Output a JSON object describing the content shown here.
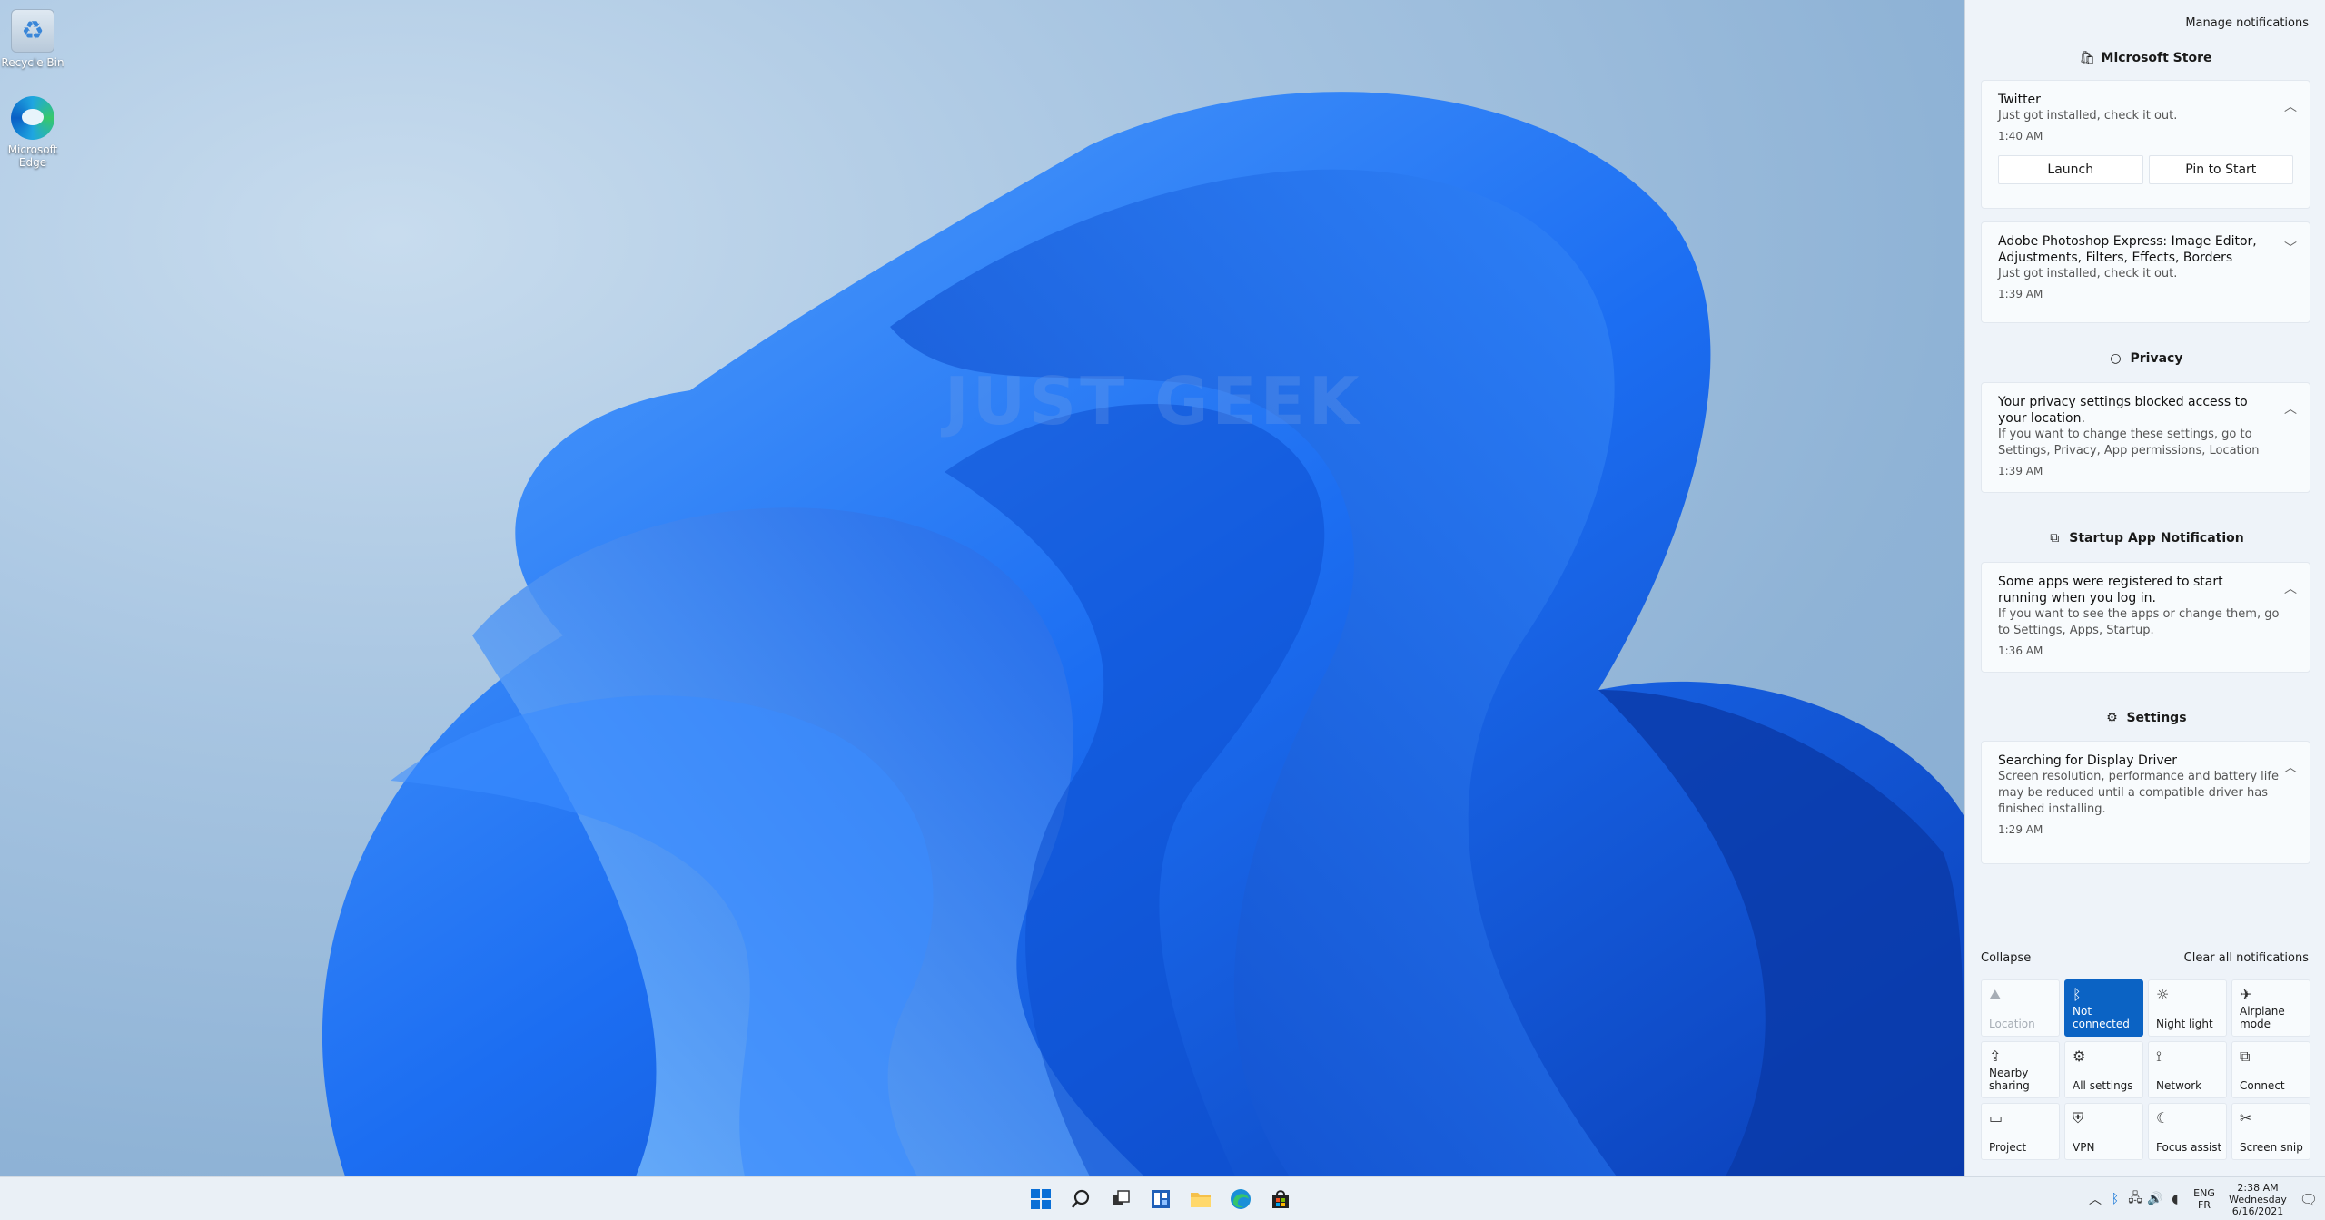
{
  "desktop": {
    "icons": [
      {
        "label": "Recycle Bin",
        "icon": "recycle-bin-icon"
      },
      {
        "label": "Microsoft Edge",
        "icon": "edge-icon"
      }
    ],
    "watermark": "JUST GEEK"
  },
  "action_center": {
    "manage_label": "Manage notifications",
    "groups": [
      {
        "title": "Microsoft Store",
        "icon": "store-bag-icon",
        "notifications": [
          {
            "title": "Twitter",
            "body": "Just got installed, check it out.",
            "time": "1:40 AM",
            "buttons": [
              "Launch",
              "Pin to Start"
            ]
          },
          {
            "title": "Adobe Photoshop Express: Image Editor, Adjustments, Filters, Effects, Borders",
            "body": "Just got installed, check it out.",
            "time": "1:39 AM"
          }
        ]
      },
      {
        "title": "Privacy",
        "icon": "privacy-icon",
        "notifications": [
          {
            "title": "Your privacy settings blocked access to your location.",
            "body": "If you want to change these settings, go to Settings, Privacy, App permissions, Location",
            "time": "1:39 AM"
          }
        ]
      },
      {
        "title": "Startup App Notification",
        "icon": "startup-icon",
        "notifications": [
          {
            "title": "Some apps were registered to start running when you log in.",
            "body": "If you want to see the apps or change them, go to Settings, Apps, Startup.",
            "time": "1:36 AM"
          }
        ]
      },
      {
        "title": "Settings",
        "icon": "gear-icon",
        "notifications": [
          {
            "title": "Searching for Display Driver",
            "body": "Screen resolution, performance and battery life may be reduced until a compatible driver has finished installing.",
            "time": "1:29 AM"
          }
        ]
      }
    ],
    "collapse_label": "Collapse",
    "clear_label": "Clear all notifications",
    "quick_actions": [
      {
        "label": "Location",
        "icon": "location-icon",
        "state": "disabled"
      },
      {
        "label": "Not connected",
        "icon": "bluetooth-icon",
        "state": "on"
      },
      {
        "label": "Night light",
        "icon": "night-light-icon",
        "state": "off"
      },
      {
        "label": "Airplane mode",
        "icon": "airplane-icon",
        "state": "off"
      },
      {
        "label": "Nearby sharing",
        "icon": "nearby-sharing-icon",
        "state": "off"
      },
      {
        "label": "All settings",
        "icon": "gear-icon",
        "state": "off"
      },
      {
        "label": "Network",
        "icon": "network-icon",
        "state": "off"
      },
      {
        "label": "Connect",
        "icon": "connect-icon",
        "state": "off"
      },
      {
        "label": "Project",
        "icon": "project-icon",
        "state": "off"
      },
      {
        "label": "VPN",
        "icon": "vpn-icon",
        "state": "off"
      },
      {
        "label": "Focus assist",
        "icon": "focus-assist-icon",
        "state": "off"
      },
      {
        "label": "Screen snip",
        "icon": "screen-snip-icon",
        "state": "off"
      }
    ]
  },
  "taskbar": {
    "apps": [
      "start-icon",
      "search-icon",
      "task-view-icon",
      "widgets-icon",
      "file-explorer-icon",
      "edge-icon",
      "store-icon"
    ],
    "tray": {
      "lang_line1": "ENG",
      "lang_line2": "FR",
      "time": "2:38 AM",
      "day": "Wednesday",
      "date": "6/16/2021"
    }
  },
  "colors": {
    "accent": "#0b63c4",
    "panel_bg": "#eef3f9",
    "taskbar_bg": "#eaf0f6"
  }
}
